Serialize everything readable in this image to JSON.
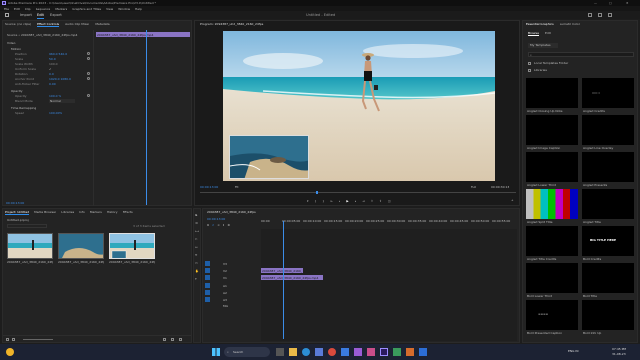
{
  "window": {
    "title": "Adobe Premiere Pro 2023 - C:\\Users\\user\\OneDrive\\Documents\\Adobe\\Premiere Pro\\23.0\\Untitled *",
    "controls": [
      "—",
      "▢",
      "✕"
    ]
  },
  "menu": [
    "File",
    "Edit",
    "Clip",
    "Sequence",
    "Markers",
    "Graphics and Titles",
    "View",
    "Window",
    "Help"
  ],
  "workspace": {
    "tabs": [
      "Import",
      "Edit",
      "Export"
    ],
    "active": "Edit",
    "center_title": "Untitled - Edited"
  },
  "effect_controls": {
    "tabs": [
      "Source: (no clips)",
      "Effect Controls",
      "Audio Clip Mixer",
      "Metadata"
    ],
    "source_label": "Source • 2094387_uhd_3840_2160_24fps.mp4",
    "clip_bar": "2094387_uhd_3840_2160_24fps.mp4",
    "section_video": "Video",
    "props": [
      {
        "name": "Motion",
        "value": ""
      },
      {
        "name": "Position",
        "value": "960.0   540.0"
      },
      {
        "name": "Scale",
        "value": "50.0"
      },
      {
        "name": "Scale Width",
        "value": "100.0"
      },
      {
        "name": "Uniform Scale",
        "value": "✓"
      },
      {
        "name": "Rotation",
        "value": "0.0"
      },
      {
        "name": "Anchor Point",
        "value": "1920.0   1080.0"
      },
      {
        "name": "Anti-flicker Filter",
        "value": "0.00"
      },
      {
        "name": "Opacity",
        "value": ""
      },
      {
        "name": "Opacity",
        "value": "100.0 %"
      },
      {
        "name": "Blend Mode",
        "value": "Normal"
      },
      {
        "name": "Time Remapping",
        "value": ""
      },
      {
        "name": "Speed",
        "value": "100.00%"
      }
    ],
    "timecode": "00:00:13:00"
  },
  "program": {
    "title": "Program: 2094387_uhd_3840_2160_24fps",
    "timecode_left": "00:00:13:00",
    "fit": "Fit",
    "quality": "Full",
    "timecode_right": "00:00:30:13"
  },
  "essential_graphics": {
    "tabs": [
      "Essential Graphics",
      "Lumetri Color"
    ],
    "subtabs": [
      "Browse",
      "Edit"
    ],
    "dropdown": "My Templates",
    "check1": "Local Templates Folder",
    "check2": "Libraries",
    "templates": [
      "Angled Closing Up Note",
      "Angled Credits",
      "Angled Image Caption",
      "Angled Line Overlay",
      "Angled Lower Third",
      "Angled Presents",
      "Angled Split Title",
      "Angled Title",
      "Angled Title Credits",
      "Bold Credits",
      "Bold Lower Third",
      "Bold Title",
      "Bold Presented Caption",
      "Bold Info Up",
      "Bold Rolling Credits",
      "Bold Title 2"
    ],
    "sample_title": "BIG TITLE HERE"
  },
  "project": {
    "tabs": [
      "Project: Untitled",
      "Media Browser",
      "Libraries",
      "Info",
      "Markers",
      "History",
      "Effects"
    ],
    "path": "Untitled.prproj",
    "item_count": "3 of 3 items selected",
    "items": [
      {
        "name": "2094387_uhd_3840_2160_24fps.mp4",
        "dur": "30:13"
      },
      {
        "name": "2094387_uhd_3840_2160_24fps.mp4",
        "dur": "30:13"
      },
      {
        "name": "2094387_uhd_3840_2160_24fps",
        "dur": "30:13"
      }
    ]
  },
  "timeline": {
    "tab": "2094387_uhd_3840_2160_24fps",
    "timecode": "00:00:13:00",
    "ruler": [
      "00:00",
      "00:00:05:00",
      "00:00:10:00",
      "00:00:15:00",
      "00:00:20:00",
      "00:00:25:00",
      "00:00:30:00",
      "00:00:35:00",
      "00:00:40:00",
      "00:00:45:00",
      "00:00:50:00",
      "00:00:55:00"
    ],
    "tracks": [
      "V3",
      "V2",
      "V1",
      "A1",
      "A2",
      "A3"
    ],
    "clip_v2": "2094387_uhd_3840_2160_24fps.mp4",
    "clip_v1": "2094387_uhd_3840_2160_24fps.mp4",
    "mix": "Mix"
  },
  "taskbar": {
    "search": "Search",
    "lang": "ENG IN",
    "time": "07:45 PM",
    "date": "31-08-23"
  },
  "colors": {
    "accent": "#2d8ceb",
    "clip_purple": "#8a74c4",
    "timecode_blue": "#3b8ce8",
    "panel": "#232323"
  }
}
